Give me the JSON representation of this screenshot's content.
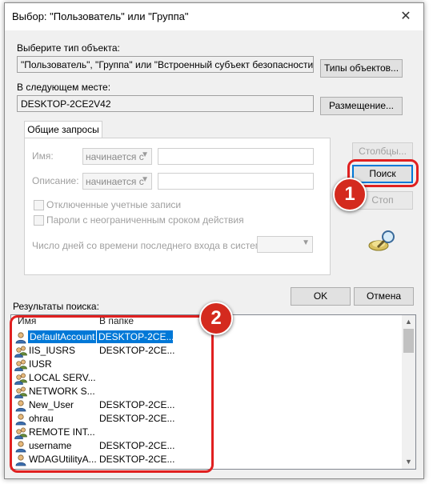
{
  "window": {
    "title": "Выбор: \"Пользователь\" или \"Группа\"",
    "close_glyph": "✕"
  },
  "object_type": {
    "label": "Выберите тип объекта:",
    "value": "\"Пользователь\", \"Группа\" или \"Встроенный субъект безопасности\"",
    "button": "Типы объектов..."
  },
  "location": {
    "label": "В следующем месте:",
    "value": "DESKTOP-2CE2V42",
    "button": "Размещение..."
  },
  "tab": {
    "label": "Общие запросы"
  },
  "query": {
    "name_label": "Имя:",
    "name_combo": "начинается с",
    "desc_label": "Описание:",
    "desc_combo": "начинается с",
    "disabled_accounts": "Отключенные учетные записи",
    "nonexpiring_passwords": "Пароли с неограниченным сроком действия",
    "days_label": "Число дней со времени последнего входа в систему:"
  },
  "buttons": {
    "columns": "Столбцы...",
    "search": "Поиск",
    "stop": "Стоп",
    "ok": "OK",
    "cancel": "Отмена"
  },
  "results": {
    "label": "Результаты поиска:",
    "headers": [
      "Имя",
      "В папке"
    ],
    "rows": [
      {
        "name": "DefaultAccount",
        "folder": "DESKTOP-2CE...",
        "icon": "user-icon",
        "selected": true
      },
      {
        "name": "IIS_IUSRS",
        "folder": "DESKTOP-2CE...",
        "icon": "group-icon"
      },
      {
        "name": "IUSR",
        "folder": "",
        "icon": "group-icon"
      },
      {
        "name": "LOCAL SERV...",
        "folder": "",
        "icon": "group-icon"
      },
      {
        "name": "NETWORK S...",
        "folder": "",
        "icon": "group-icon"
      },
      {
        "name": "New_User",
        "folder": "DESKTOP-2CE...",
        "icon": "user-icon"
      },
      {
        "name": "ohrau",
        "folder": "DESKTOP-2CE...",
        "icon": "user-icon"
      },
      {
        "name": "REMOTE INT...",
        "folder": "",
        "icon": "group-icon"
      },
      {
        "name": "username",
        "folder": "DESKTOP-2CE...",
        "icon": "user-icon"
      },
      {
        "name": "WDAGUtilityA...",
        "folder": "DESKTOP-2CE...",
        "icon": "user-icon"
      }
    ]
  },
  "annotations": {
    "one": "1",
    "two": "2"
  },
  "colors": {
    "callout": "#e02020",
    "badge": "#d42a1e",
    "selection": "#0078d7",
    "search_focus": "#0078d7"
  }
}
